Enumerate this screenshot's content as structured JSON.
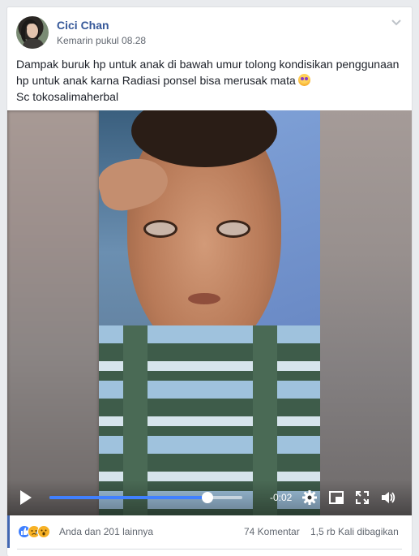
{
  "post": {
    "author": "Cici Chan",
    "timestamp": "Kemarin pukul 08.28",
    "text_line1": "Dampak buruk hp untuk anak di bawah umur tolong kondisikan penggunaan",
    "text_line2": "hp untuk anak karna Radiasi ponsel bisa merusak mata",
    "text_line3": "Sc tokosalimaherbal",
    "text_emoji": "woozy-face-emoji"
  },
  "video": {
    "time_remaining": "-0:02",
    "progress_fraction": 0.82,
    "icons": {
      "play": "play-icon",
      "settings": "gear-icon",
      "pip": "picture-in-picture-icon",
      "fullscreen": "fullscreen-icon",
      "volume": "volume-icon"
    }
  },
  "footer": {
    "reactions": [
      "like",
      "sad",
      "wow"
    ],
    "reactions_label": "Anda dan 201 lainnya",
    "comments": "74 Komentar",
    "shares": "1,5 rb Kali dibagikan"
  },
  "colors": {
    "author_link": "#365899",
    "accent": "#4267b2",
    "progress": "#4080ff",
    "muted_text": "#616770",
    "body_text": "#1d2129"
  }
}
